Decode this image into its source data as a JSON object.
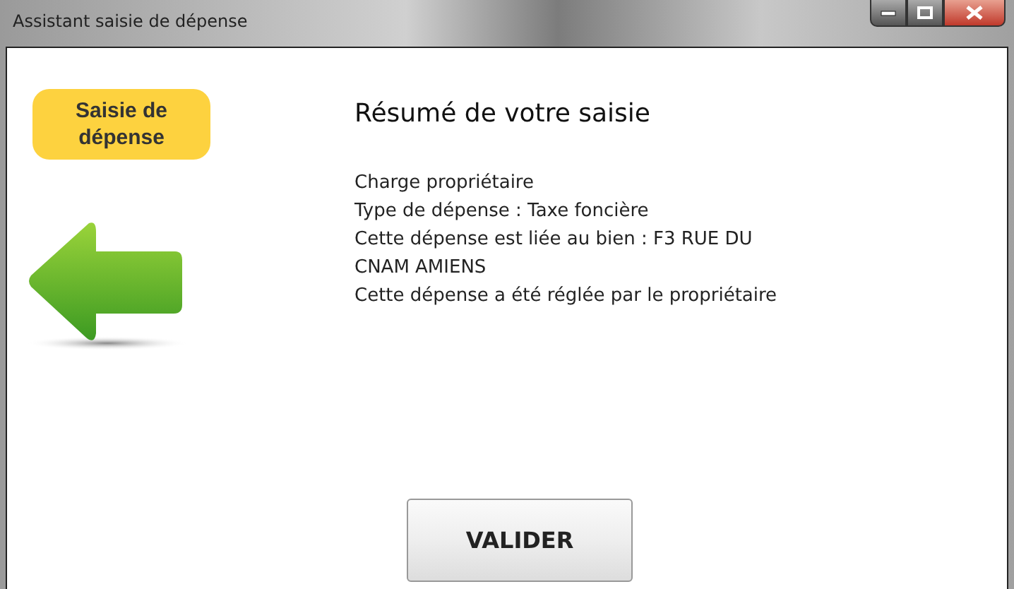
{
  "window": {
    "title": "Assistant saisie de dépense"
  },
  "step_badge": "Saisie de dépense",
  "heading": "Résumé de votre saisie",
  "summary_lines": [
    "Charge propriétaire",
    "Type de dépense : Taxe foncière",
    "Cette dépense est liée au bien : F3 RUE DU CNAM AMIENS",
    "Cette dépense a été réglée par le propriétaire"
  ],
  "buttons": [
    "VALIDER"
  ]
}
